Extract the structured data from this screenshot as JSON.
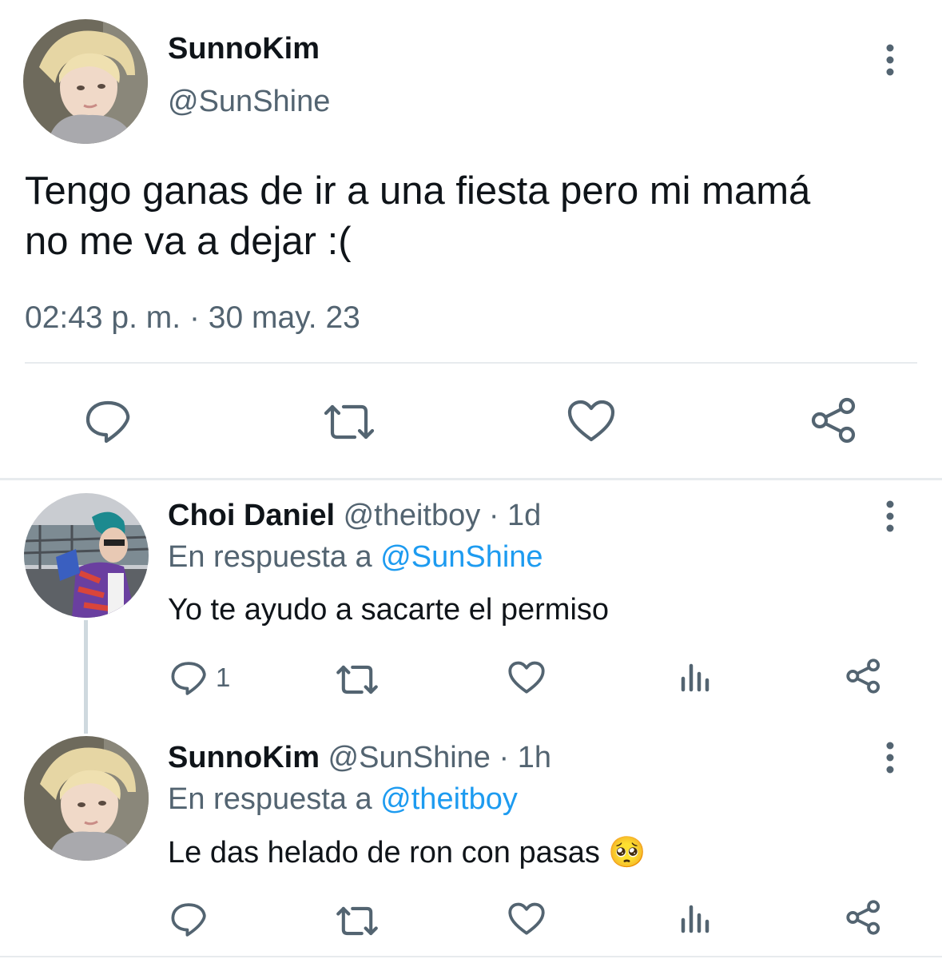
{
  "main_tweet": {
    "display_name": "SunnoKim",
    "handle": "@SunShine",
    "text_line1": "Tengo ganas de ir a una fiesta pero mi mamá",
    "text_line2": "no me va a dejar :(",
    "timestamp": "02:43 p. m. · 30 may. 23",
    "actions": [
      "reply-icon",
      "retweet-icon",
      "like-icon",
      "share-icon"
    ]
  },
  "replies": [
    {
      "display_name": "Choi Daniel",
      "handle_time": "@theitboy · 1d",
      "reply_prefix": "En respuesta a",
      "reply_to": "@SunShine",
      "text": "Yo te ayudo a sacarte el permiso",
      "reply_count": "1",
      "actions": [
        "reply-icon",
        "retweet-icon",
        "like-icon",
        "analytics-icon",
        "share-icon"
      ]
    },
    {
      "display_name": "SunnoKim",
      "handle_time": "@SunShine · 1h",
      "reply_prefix": "En respuesta a",
      "reply_to": "@theitboy",
      "text": "Le das helado de ron con pasas",
      "emoji": "🥺",
      "actions": [
        "reply-icon",
        "retweet-icon",
        "like-icon",
        "analytics-icon",
        "share-icon"
      ]
    }
  ],
  "colors": {
    "text": "#0f1419",
    "secondary": "#536471",
    "link": "#1d9bf0",
    "divider": "#e7ebee"
  }
}
